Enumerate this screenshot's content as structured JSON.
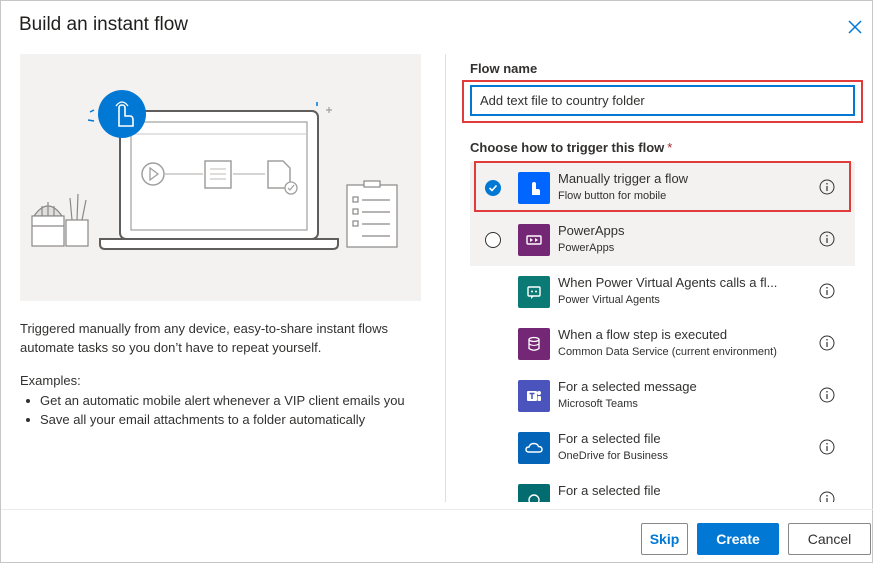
{
  "dialog": {
    "title": "Build an instant flow",
    "close_icon": "close-icon"
  },
  "left": {
    "description": "Triggered manually from any device, easy-to-share instant flows automate tasks so you don’t have to repeat yourself.",
    "examples_heading": "Examples:",
    "examples": [
      "Get an automatic mobile alert whenever a VIP client emails you",
      "Save all your email attachments to a folder automatically"
    ]
  },
  "form": {
    "flow_name_label": "Flow name",
    "flow_name_value": "Add text file to country folder",
    "trigger_label": "Choose how to trigger this flow",
    "required_mark": "*"
  },
  "triggers": [
    {
      "name": "Manually trigger a flow",
      "connector": "Flow button for mobile",
      "icon": "hand-tap-icon",
      "color": "#0066ff",
      "radio": "checked"
    },
    {
      "name": "PowerApps",
      "connector": "PowerApps",
      "icon": "powerapps-icon",
      "color": "#742774",
      "radio": "unchecked"
    },
    {
      "name": "When Power Virtual Agents calls a fl...",
      "connector": "Power Virtual Agents",
      "icon": "power-virtual-agents-icon",
      "color": "#0b7a75",
      "radio": "none"
    },
    {
      "name": "When a flow step is executed",
      "connector": "Common Data Service (current environment)",
      "icon": "database-icon",
      "color": "#742774",
      "radio": "none"
    },
    {
      "name": "For a selected message",
      "connector": "Microsoft Teams",
      "icon": "teams-icon",
      "color": "#4b53bc",
      "radio": "none"
    },
    {
      "name": "For a selected file",
      "connector": "OneDrive for Business",
      "icon": "cloud-icon",
      "color": "#0364b8",
      "radio": "none"
    },
    {
      "name": "For a selected file",
      "connector": "",
      "icon": "sharepoint-icon",
      "color": "#036c70",
      "radio": "none"
    }
  ],
  "footer": {
    "skip": "Skip",
    "create": "Create",
    "cancel": "Cancel"
  },
  "colors": {
    "accent": "#0078d4",
    "highlight_box": "#e03c3c"
  }
}
